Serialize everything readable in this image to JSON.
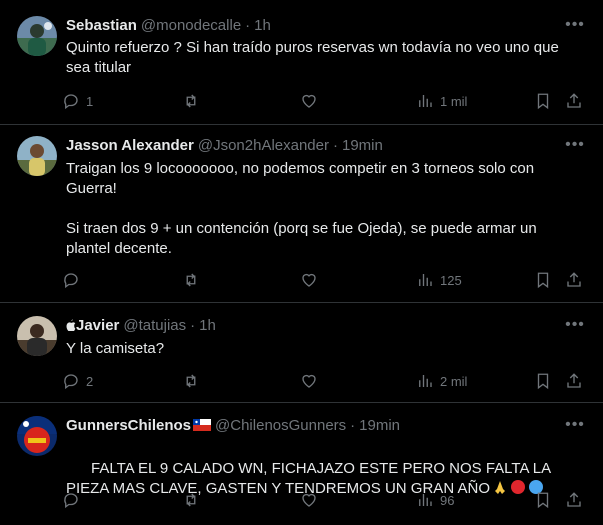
{
  "tweets": [
    {
      "name": "Sebastian",
      "handle": "@monodecalle",
      "time": "1h",
      "text": "Quinto refuerzo ? Si han traído puros reservas wn todavía no veo uno que sea titular",
      "replies": "1",
      "retweets": "",
      "likes": "",
      "views": "1 mil"
    },
    {
      "name": "Jasson Alexander",
      "handle": "@Json2hAlexander",
      "time": "19min",
      "text": "Traigan los 9 locooooooo, no podemos competir en 3 torneos solo con Guerra!\n\nSi traen dos 9 + un contención (porq se fue Ojeda), se puede armar un plantel decente.",
      "replies": "",
      "retweets": "",
      "likes": "",
      "views": "125"
    },
    {
      "name": "Javier",
      "handle": "@tatujias",
      "time": "1h",
      "text": "Y la camiseta?",
      "replies": "2",
      "retweets": "",
      "likes": "",
      "views": "2 mil"
    },
    {
      "name": "GunnersChilenos",
      "handle": "@ChilenosGunners",
      "time": "19min",
      "text": "FALTA EL 9 CALADO WN, FICHAJAZO ESTE PERO NOS FALTA LA PIEZA MAS CLAVE, GASTEN Y TENDREMOS UN GRAN AÑO",
      "replies": "",
      "retweets": "",
      "likes": "",
      "views": "96"
    }
  ],
  "colors": {
    "background": "#000000",
    "text": "#e7e9ea",
    "muted": "#71767b",
    "divider": "#2f3336"
  },
  "icons": [
    "reply-icon",
    "retweet-icon",
    "like-icon",
    "views-icon",
    "bookmark-icon",
    "share-icon",
    "more-icon",
    "apple-icon",
    "chile-flag-icon"
  ]
}
